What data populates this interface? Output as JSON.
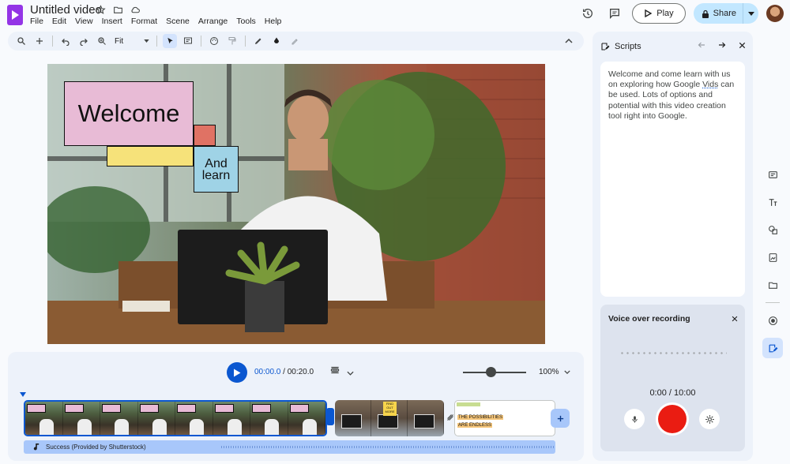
{
  "app": {
    "doc_title": "Untitled video",
    "menu": [
      "File",
      "Edit",
      "View",
      "Insert",
      "Format",
      "Scene",
      "Arrange",
      "Tools",
      "Help"
    ],
    "play_label": "Play",
    "share_label": "Share"
  },
  "toolbar": {
    "zoom_value": "Fit"
  },
  "canvas": {
    "welcome_text": "Welcome",
    "and_learn_text": "And learn"
  },
  "timeline": {
    "current_time": "00:00.0",
    "separator": " / ",
    "total_time": "00:20.0",
    "zoom_percent": "100%",
    "clip1_label": "Welcome",
    "clip2_tag": "FIND OUT MORE",
    "clip3_line1": "THE POSSIBILITIES",
    "clip3_line2": "ARE ENDLESS",
    "audio_label": "Success (Provided by Shutterstock)"
  },
  "scripts_panel": {
    "title": "Scripts",
    "script_part1": "Welcome and come learn with us on exploring how Google ",
    "script_underlined": "Vids",
    "script_part2": " can be used. Lots of options and potential with this video creation tool right into Google."
  },
  "voice_over": {
    "title": "Voice over recording",
    "time": "0:00 / 10:00"
  },
  "colors": {
    "accent": "#0b57d0",
    "record": "#ea1c12",
    "welcome_box": "#e8bbd6",
    "yellow_box": "#f6e27a",
    "blue_box": "#9fd3e6",
    "red_box": "#e07264"
  }
}
